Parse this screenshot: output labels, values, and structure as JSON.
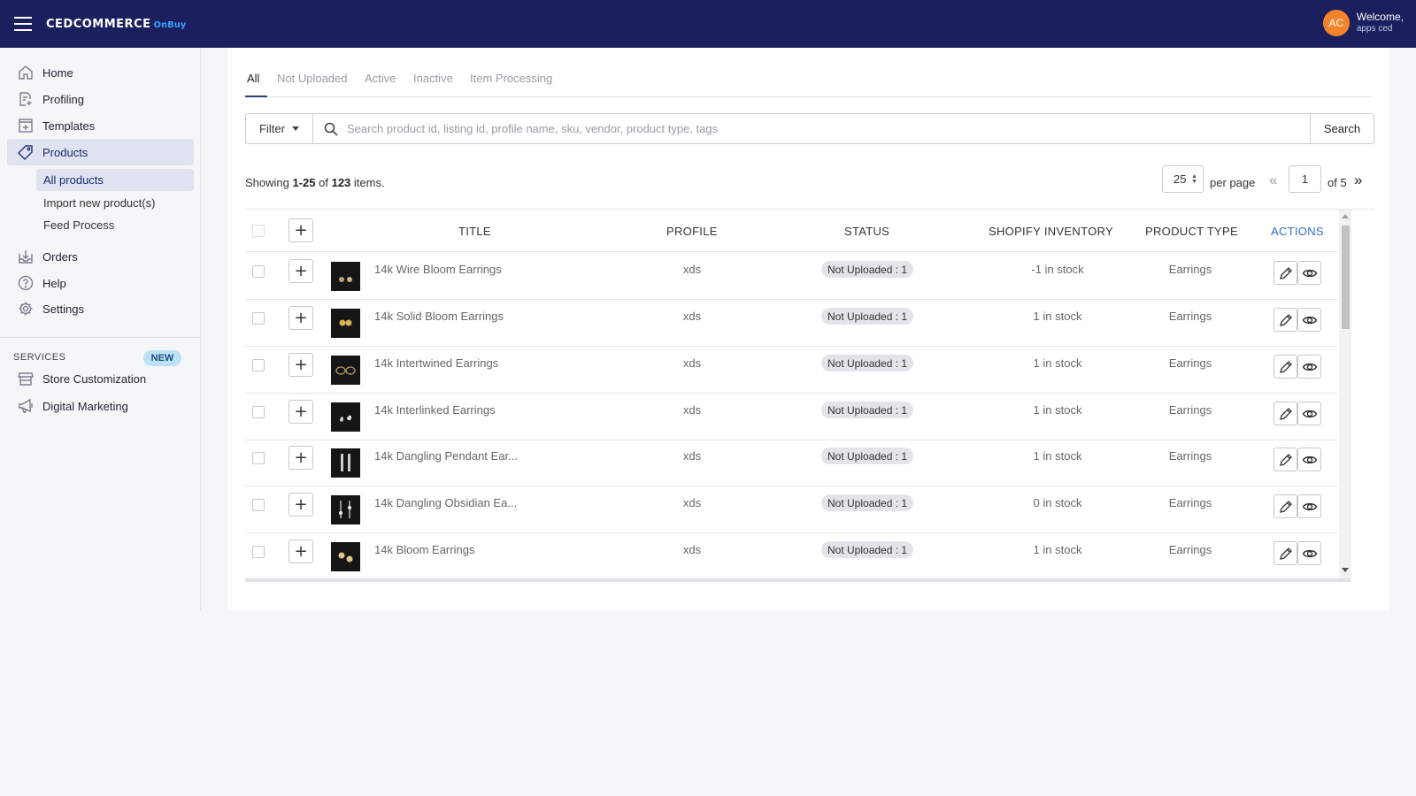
{
  "header": {
    "logo_main": "CEDCOMMERCE",
    "logo_sub": "OnBuy",
    "avatar_initials": "AC",
    "welcome": "Welcome,",
    "username": "apps ced"
  },
  "sidebar": {
    "items": [
      {
        "label": "Home",
        "icon": "home-icon"
      },
      {
        "label": "Profiling",
        "icon": "profiling-icon"
      },
      {
        "label": "Templates",
        "icon": "templates-icon"
      },
      {
        "label": "Products",
        "icon": "tag-icon"
      },
      {
        "label": "Orders",
        "icon": "orders-icon"
      },
      {
        "label": "Help",
        "icon": "help-icon"
      },
      {
        "label": "Settings",
        "icon": "gear-icon"
      }
    ],
    "sub_items": [
      "All products",
      "Import new product(s)",
      "Feed Process"
    ],
    "services_header": "SERVICES",
    "new_badge": "NEW",
    "services": [
      {
        "label": "Store Customization",
        "icon": "store-icon"
      },
      {
        "label": "Digital Marketing",
        "icon": "megaphone-icon"
      }
    ]
  },
  "tabs": [
    "All",
    "Not Uploaded",
    "Active",
    "Inactive",
    "Item Processing"
  ],
  "toolbar": {
    "filter_label": "Filter",
    "search_placeholder": "Search product id, listing id, profile name, sku, vendor, product type, tags",
    "search_button": "Search"
  },
  "summary": {
    "prefix": "Showing ",
    "range": "1-25",
    "of": " of ",
    "total": "123",
    "suffix": " items."
  },
  "pagination": {
    "per_page": "25",
    "per_page_label": "per page",
    "current_page": "1",
    "of_pages": "of 5",
    "prev": "«",
    "next": "»"
  },
  "table": {
    "headers": {
      "title": "TITLE",
      "profile": "PROFILE",
      "status": "STATUS",
      "inventory": "SHOPIFY INVENTORY",
      "product_type": "PRODUCT TYPE",
      "actions": "ACTIONS"
    },
    "rows": [
      {
        "title": "14k Wire Bloom Earrings",
        "profile": "xds",
        "status": "Not Uploaded : 1",
        "inventory": "-1 in stock",
        "type": "Earrings"
      },
      {
        "title": "14k Solid Bloom Earrings",
        "profile": "xds",
        "status": "Not Uploaded : 1",
        "inventory": "1 in stock",
        "type": "Earrings"
      },
      {
        "title": "14k Intertwined Earrings",
        "profile": "xds",
        "status": "Not Uploaded : 1",
        "inventory": "1 in stock",
        "type": "Earrings"
      },
      {
        "title": "14k Interlinked Earrings",
        "profile": "xds",
        "status": "Not Uploaded : 1",
        "inventory": "1 in stock",
        "type": "Earrings"
      },
      {
        "title": "14k Dangling Pendant Ear...",
        "profile": "xds",
        "status": "Not Uploaded : 1",
        "inventory": "1 in stock",
        "type": "Earrings"
      },
      {
        "title": "14k Dangling Obsidian Ea...",
        "profile": "xds",
        "status": "Not Uploaded : 1",
        "inventory": "0 in stock",
        "type": "Earrings"
      },
      {
        "title": "14k Bloom Earrings",
        "profile": "xds",
        "status": "Not Uploaded : 1",
        "inventory": "1 in stock",
        "type": "Earrings"
      }
    ]
  },
  "colors": {
    "header_bg": "#1b1f5e",
    "avatar": "#f4832a",
    "actions_header": "#2f6fd0",
    "active_nav_bg": "#dfe3f0"
  }
}
